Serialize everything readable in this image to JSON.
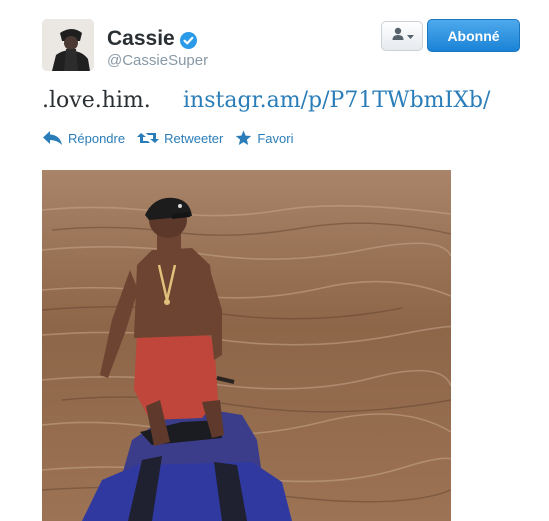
{
  "user": {
    "name": "Cassie",
    "handle": "@CassieSuper",
    "verified": true
  },
  "buttons": {
    "follow_label": "Abonné"
  },
  "tweet": {
    "text": ".love.him.",
    "link_text": "instagr.am/p/P71TWbmIXb/"
  },
  "actions": [
    {
      "label": "Répondre",
      "icon": "reply-icon"
    },
    {
      "label": "Retweeter",
      "icon": "retweet-icon"
    },
    {
      "label": "Favori",
      "icon": "star-icon"
    }
  ],
  "colors": {
    "link": "#2a7db8",
    "follow_button": "#2b8fe0",
    "verified_badge": "#2b9ae8"
  }
}
